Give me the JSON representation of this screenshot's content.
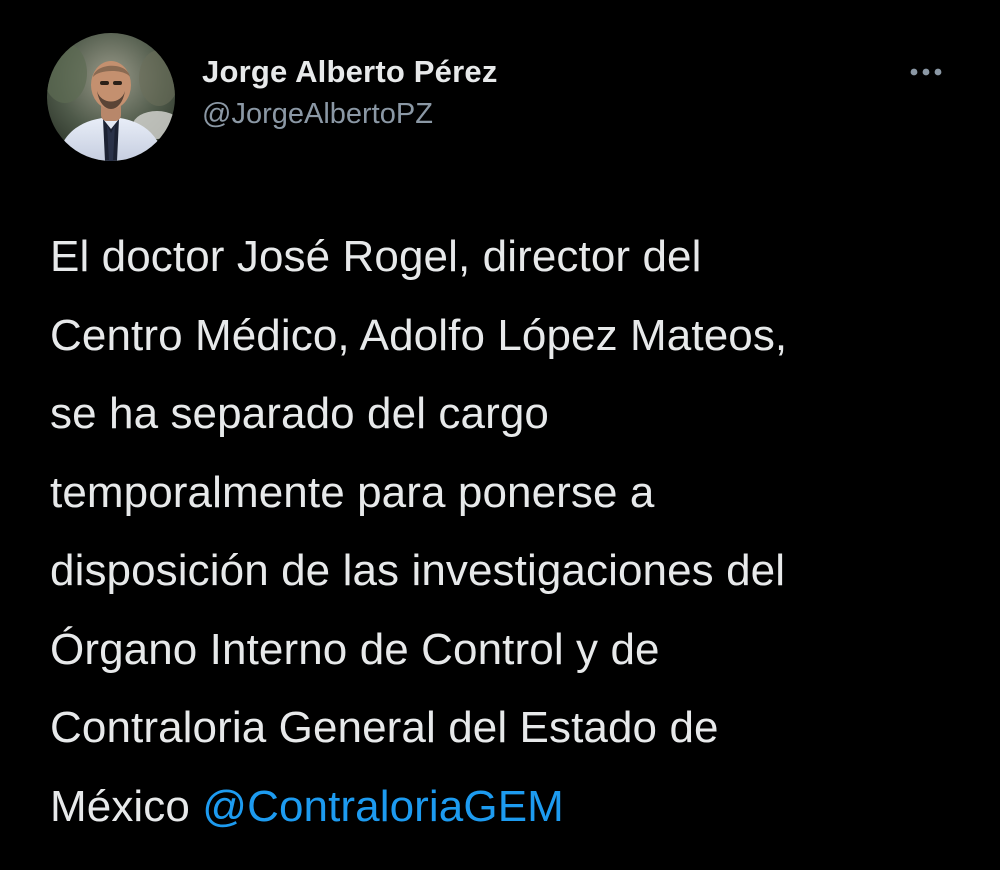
{
  "author": {
    "display_name": "Jorge Alberto Pérez",
    "handle": "@JorgeAlbertoPZ",
    "avatar_icon": "profile-photo"
  },
  "menu": {
    "more_icon": "more-horizontal-icon",
    "more_glyph": "•••"
  },
  "tweet": {
    "lines": [
      "El doctor José Rogel, director del",
      "Centro Médico, Adolfo López Mateos,",
      "se ha separado del cargo",
      "temporalmente para ponerse a",
      "disposición de las investigaciones del",
      "Órgano Interno de Control y de",
      "Contraloria General del Estado de"
    ],
    "last_line_text": "México ",
    "mention": "@ContraloriaGEM"
  },
  "colors": {
    "background": "#000000",
    "primary_text": "#e7e9ea",
    "secondary_text": "#8b98a5",
    "link": "#1d9bf0"
  }
}
